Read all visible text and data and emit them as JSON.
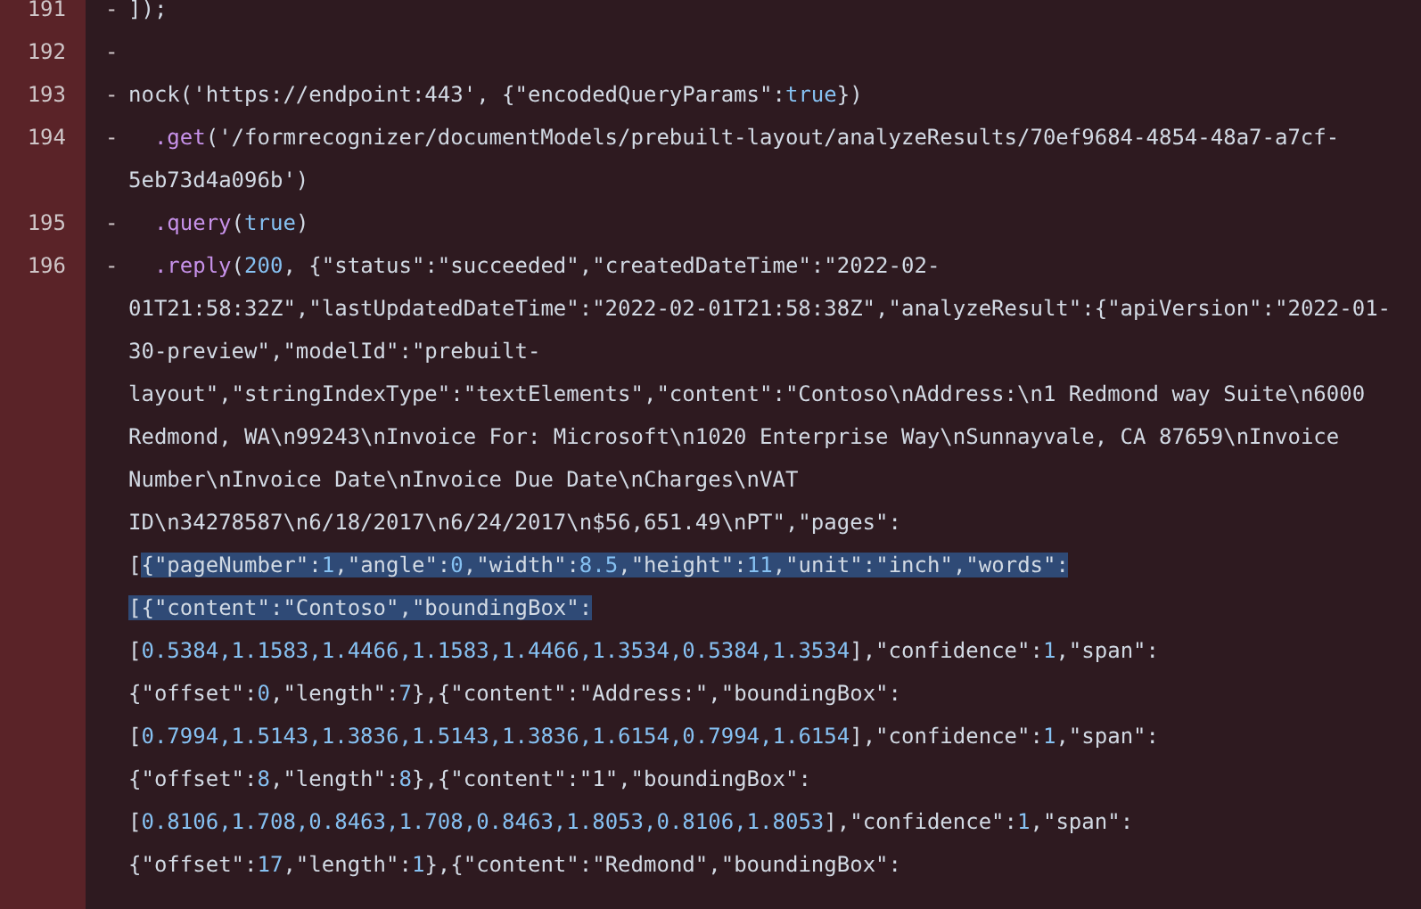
{
  "diff_lines": [
    {
      "number": "191",
      "marker": "-",
      "rows": [
        {
          "segments": [
            {
              "text": "]);",
              "kind": "text",
              "selected": false
            }
          ]
        }
      ]
    },
    {
      "number": "192",
      "marker": "-"
    },
    {
      "number": "193",
      "marker": "-",
      "rows": [
        {
          "segments": [
            {
              "text": "nock('https://endpoint:443', {\"encodedQueryParams\":",
              "kind": "text",
              "selected": false
            },
            {
              "text": "true",
              "kind": "keyword",
              "selected": false
            },
            {
              "text": "})",
              "kind": "text",
              "selected": false
            }
          ]
        }
      ]
    },
    {
      "number": "194",
      "marker": "-",
      "rows": [
        {
          "indented": true,
          "segments": [
            {
              "text": ".get",
              "kind": "call",
              "selected": false
            },
            {
              "text": "('/formrecognizer/documentModels/prebuilt-layout/analyzeResults/70ef9684-4854-48a7-a7cf-",
              "kind": "text",
              "selected": false
            }
          ]
        },
        {
          "segments": [
            {
              "text": "5eb73d4a096b')",
              "kind": "text",
              "selected": false
            }
          ]
        }
      ]
    },
    {
      "number": "195",
      "marker": "-",
      "rows": [
        {
          "indented": true,
          "segments": [
            {
              "text": ".query",
              "kind": "call",
              "selected": false
            },
            {
              "text": "(",
              "kind": "text",
              "selected": false
            },
            {
              "text": "true",
              "kind": "keyword",
              "selected": false
            },
            {
              "text": ")",
              "kind": "text",
              "selected": false
            }
          ]
        }
      ]
    },
    {
      "number": "196",
      "marker": "-",
      "rows": [
        {
          "indented": true,
          "segments": [
            {
              "text": ".reply",
              "kind": "call",
              "selected": false
            },
            {
              "text": "(",
              "kind": "text",
              "selected": false
            },
            {
              "text": "200",
              "kind": "number",
              "selected": false
            },
            {
              "text": ", {\"status\":\"succeeded\",\"createdDateTime\":\"2022-02-",
              "kind": "text",
              "selected": false
            }
          ]
        },
        {
          "segments": [
            {
              "text": "01T21:58:32Z\",\"lastUpdatedDateTime\":\"2022-02-01T21:58:38Z\",\"analyzeResult\":{\"apiVersion\":\"2022-01-",
              "kind": "text",
              "selected": false
            }
          ]
        },
        {
          "segments": [
            {
              "text": "30-preview\",\"modelId\":\"prebuilt-",
              "kind": "text",
              "selected": false
            }
          ]
        },
        {
          "segments": [
            {
              "text": "layout\",\"stringIndexType\":\"textElements\",\"content\":\"Contoso\\nAddress:\\n1 Redmond way Suite\\n6000",
              "kind": "text",
              "selected": false
            }
          ]
        },
        {
          "segments": [
            {
              "text": "Redmond, WA\\n99243\\nInvoice For: Microsoft\\n1020 Enterprise Way\\nSunnayvale, CA 87659\\nInvoice",
              "kind": "text",
              "selected": false
            }
          ]
        },
        {
          "segments": [
            {
              "text": "Number\\nInvoice Date\\nInvoice Due Date\\nCharges\\nVAT",
              "kind": "text",
              "selected": false
            }
          ]
        },
        {
          "segments": [
            {
              "text": "ID\\n34278587\\n6/18/2017\\n6/24/2017\\n$56,651.49\\nPT\",\"pages\":",
              "kind": "text",
              "selected": false
            }
          ]
        },
        {
          "segments": [
            {
              "text": "[",
              "kind": "text",
              "selected": false
            },
            {
              "text": "{\"pageNumber\":",
              "kind": "text",
              "selected": true
            },
            {
              "text": "1",
              "kind": "number",
              "selected": true
            },
            {
              "text": ",\"angle\":",
              "kind": "text",
              "selected": true
            },
            {
              "text": "0",
              "kind": "number",
              "selected": true
            },
            {
              "text": ",\"width\":",
              "kind": "text",
              "selected": true
            },
            {
              "text": "8.5",
              "kind": "number",
              "selected": true
            },
            {
              "text": ",\"height\":",
              "kind": "text",
              "selected": true
            },
            {
              "text": "11",
              "kind": "number",
              "selected": true
            },
            {
              "text": ",\"unit\":\"inch\",\"words\":",
              "kind": "text",
              "selected": true
            }
          ]
        },
        {
          "segments": [
            {
              "text": "[{\"content\":\"Contoso\",\"boundingBox\":",
              "kind": "text",
              "selected": true
            }
          ]
        },
        {
          "segments": [
            {
              "text": "[",
              "kind": "text",
              "selected": false
            },
            {
              "text": "0.5384,1.1583,1.4466,1.1583,1.4466,1.3534,0.5384,1.3534",
              "kind": "number",
              "selected": false
            },
            {
              "text": "],\"confidence\":",
              "kind": "text",
              "selected": false
            },
            {
              "text": "1",
              "kind": "number",
              "selected": false
            },
            {
              "text": ",\"span\":",
              "kind": "text",
              "selected": false
            }
          ]
        },
        {
          "segments": [
            {
              "text": "{\"offset\":",
              "kind": "text",
              "selected": false
            },
            {
              "text": "0",
              "kind": "number",
              "selected": false
            },
            {
              "text": ",\"length\":",
              "kind": "text",
              "selected": false
            },
            {
              "text": "7",
              "kind": "number",
              "selected": false
            },
            {
              "text": "},{\"content\":\"Address:\",\"boundingBox\":",
              "kind": "text",
              "selected": false
            }
          ]
        },
        {
          "segments": [
            {
              "text": "[",
              "kind": "text",
              "selected": false
            },
            {
              "text": "0.7994,1.5143,1.3836,1.5143,1.3836,1.6154,0.7994,1.6154",
              "kind": "number",
              "selected": false
            },
            {
              "text": "],\"confidence\":",
              "kind": "text",
              "selected": false
            },
            {
              "text": "1",
              "kind": "number",
              "selected": false
            },
            {
              "text": ",\"span\":",
              "kind": "text",
              "selected": false
            }
          ]
        },
        {
          "segments": [
            {
              "text": "{\"offset\":",
              "kind": "text",
              "selected": false
            },
            {
              "text": "8",
              "kind": "number",
              "selected": false
            },
            {
              "text": ",\"length\":",
              "kind": "text",
              "selected": false
            },
            {
              "text": "8",
              "kind": "number",
              "selected": false
            },
            {
              "text": "},{\"content\":\"1\",\"boundingBox\":",
              "kind": "text",
              "selected": false
            }
          ]
        },
        {
          "segments": [
            {
              "text": "[",
              "kind": "text",
              "selected": false
            },
            {
              "text": "0.8106,1.708,0.8463,1.708,0.8463,1.8053,0.8106,1.8053",
              "kind": "number",
              "selected": false
            },
            {
              "text": "],\"confidence\":",
              "kind": "text",
              "selected": false
            },
            {
              "text": "1",
              "kind": "number",
              "selected": false
            },
            {
              "text": ",\"span\":",
              "kind": "text",
              "selected": false
            }
          ]
        },
        {
          "segments": [
            {
              "text": "{\"offset\":",
              "kind": "text",
              "selected": false
            },
            {
              "text": "17",
              "kind": "number",
              "selected": false
            },
            {
              "text": ",\"length\":",
              "kind": "text",
              "selected": false
            },
            {
              "text": "1",
              "kind": "number",
              "selected": false
            },
            {
              "text": "},{\"content\":\"Redmond\",\"boundingBox\":",
              "kind": "text",
              "selected": false
            }
          ]
        }
      ]
    }
  ]
}
